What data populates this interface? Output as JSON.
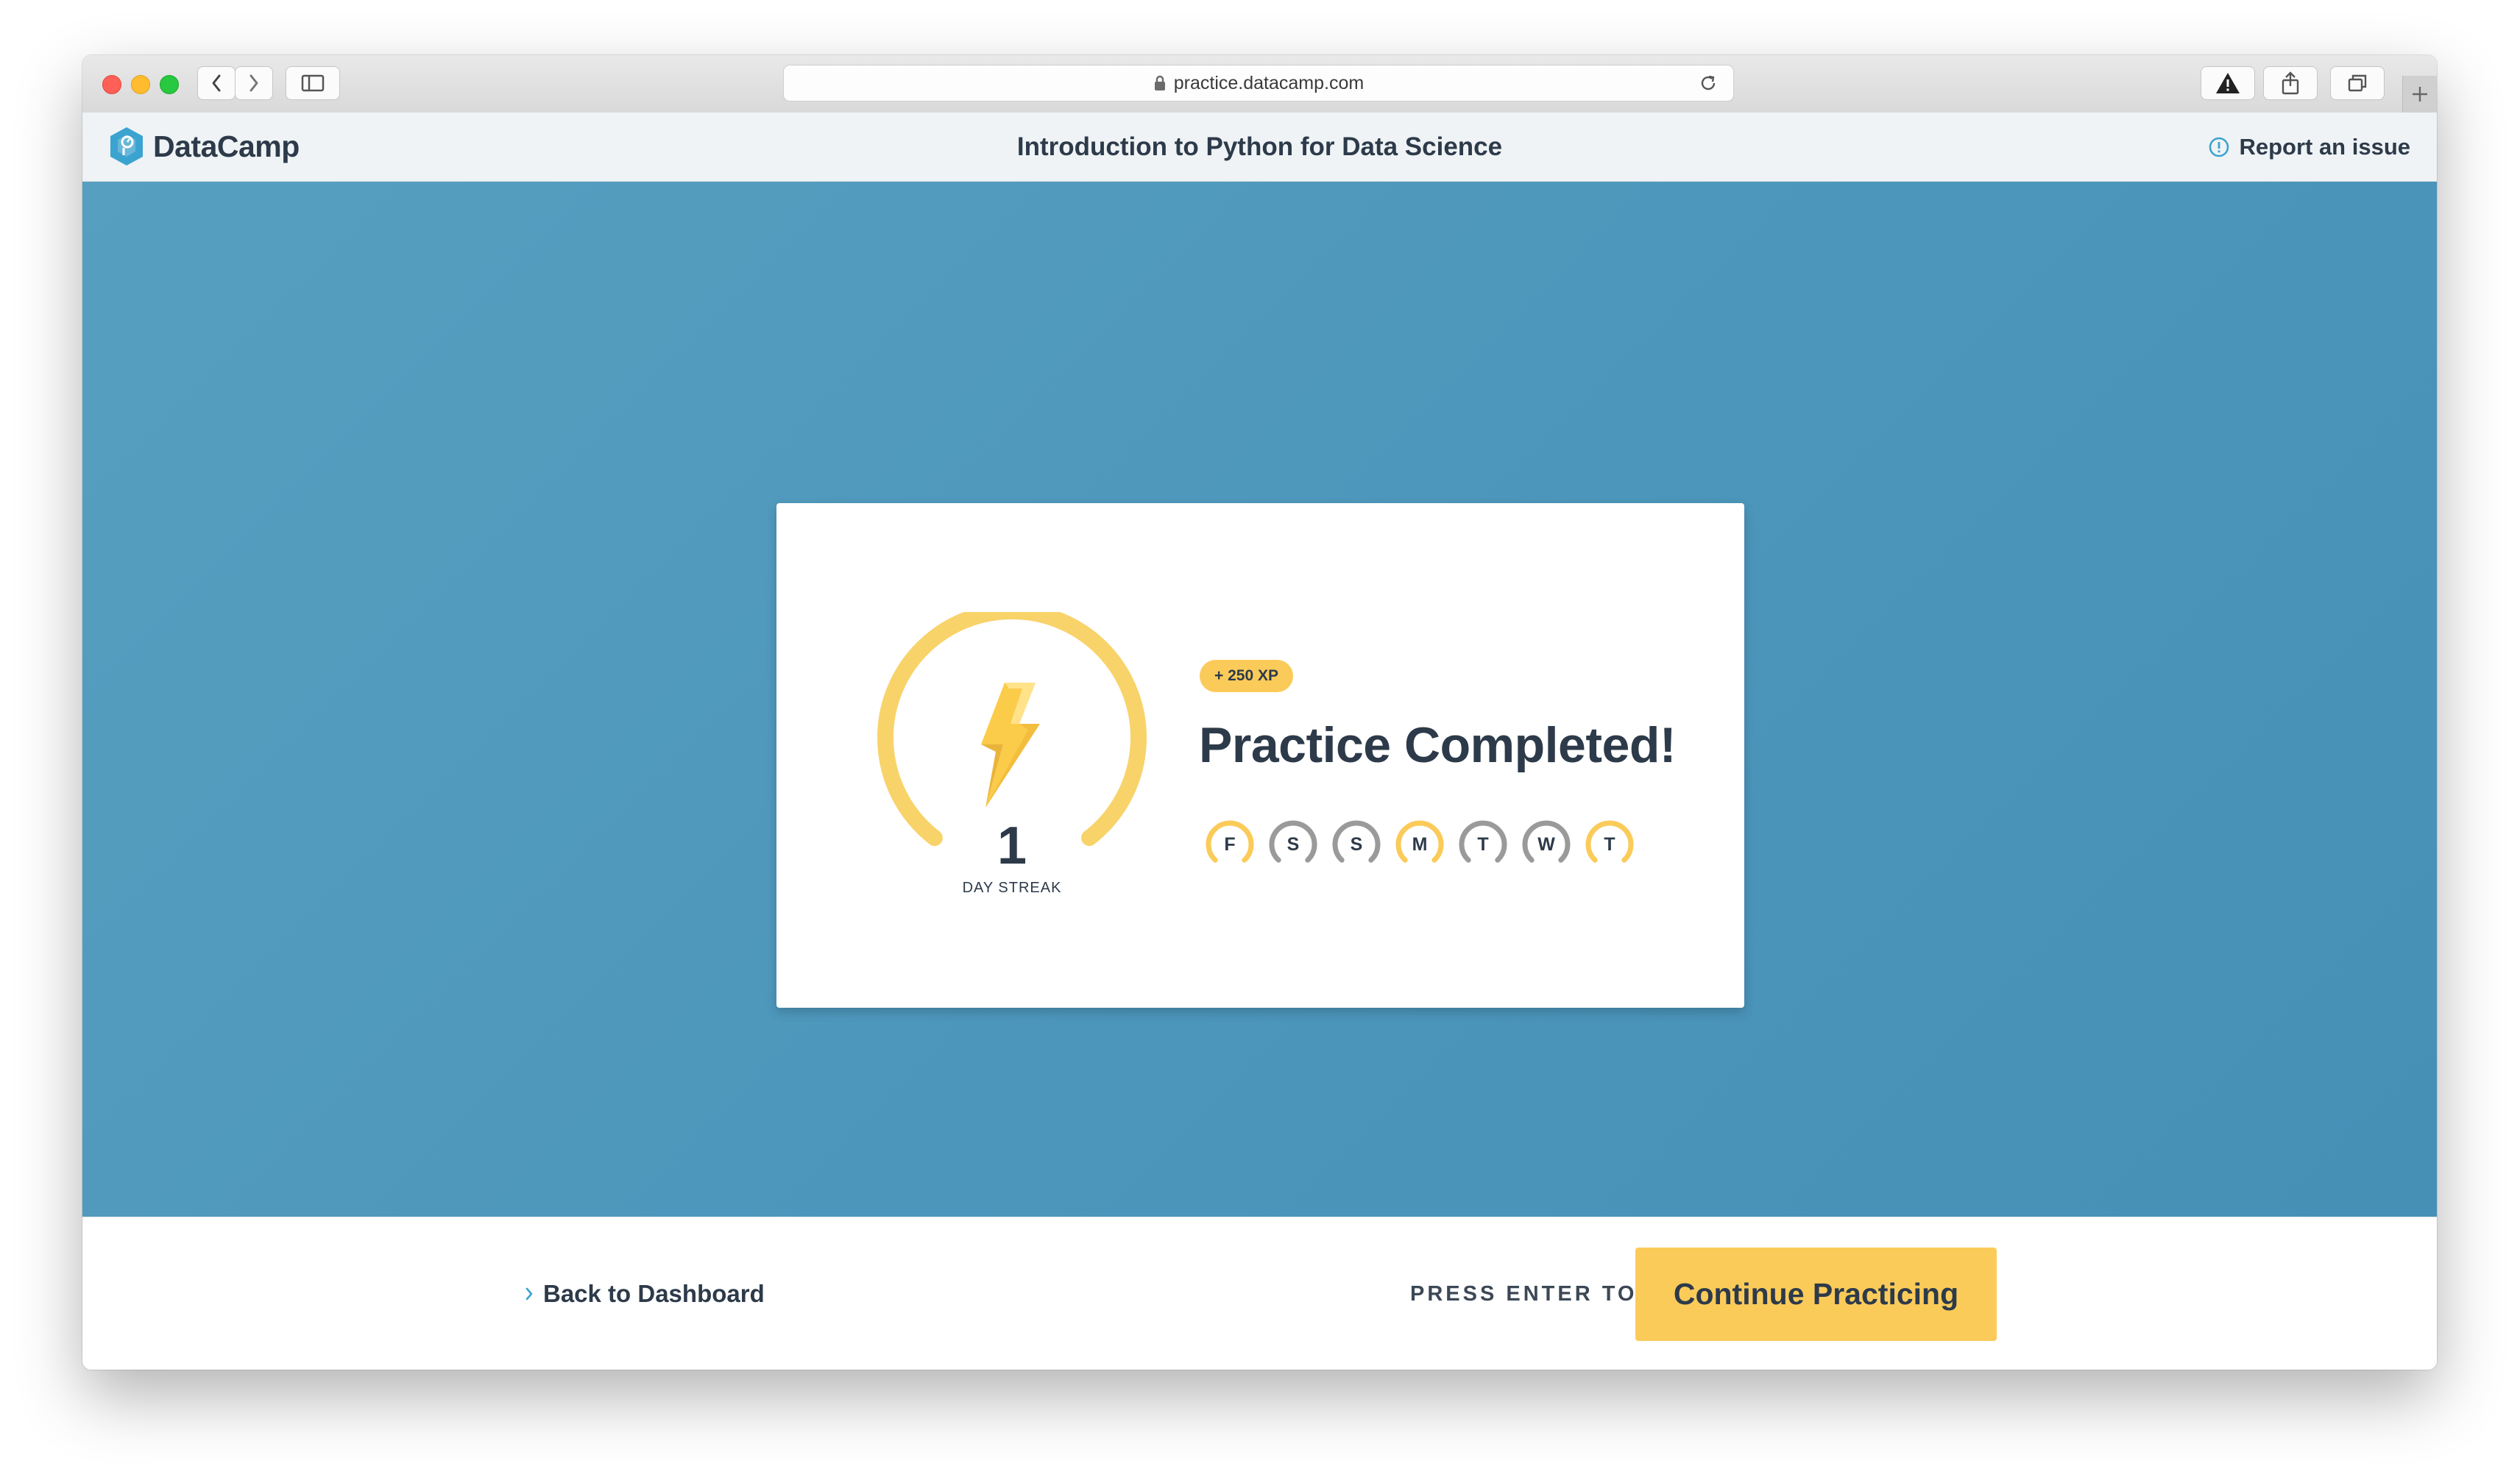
{
  "browser": {
    "url": "practice.datacamp.com"
  },
  "header": {
    "brand": "DataCamp",
    "course_title": "Introduction to Python for Data Science",
    "report_label": "Report an issue"
  },
  "result": {
    "xp_badge": "+ 250 XP",
    "title": "Practice Completed!",
    "streak_count": "1",
    "streak_label": "DAY STREAK",
    "days": [
      {
        "letter": "F",
        "status": "completed"
      },
      {
        "letter": "S",
        "status": "missed"
      },
      {
        "letter": "S",
        "status": "missed"
      },
      {
        "letter": "M",
        "status": "completed"
      },
      {
        "letter": "T",
        "status": "missed"
      },
      {
        "letter": "W",
        "status": "missed"
      },
      {
        "letter": "T",
        "status": "completed"
      }
    ]
  },
  "footer": {
    "back_label": "Back to Dashboard",
    "press_enter_label": "PRESS ENTER TO",
    "continue_label": "Continue Practicing"
  },
  "colors": {
    "accent_yellow": "#fbcb5a",
    "missed_grey": "#9a9a9a",
    "background_blue": "#4f99be",
    "text_dark": "#2d3a4a",
    "link_blue": "#3ba3d0"
  },
  "icons": {
    "back_icon": "chevron-left-icon",
    "forward_icon": "chevron-right-icon",
    "sidebar_icon": "sidebar-icon",
    "lock_icon": "lock-icon",
    "reload_icon": "reload-icon",
    "warning_icon": "warning-icon",
    "share_icon": "share-icon",
    "tabs_icon": "tabs-overview-icon",
    "new_tab_icon": "plus-icon",
    "logo_icon": "datacamp-logo-icon",
    "info_icon": "info-circle-icon",
    "streak_icon": "lightning-bolt-icon",
    "back_link_icon": "chevron-right-icon"
  }
}
